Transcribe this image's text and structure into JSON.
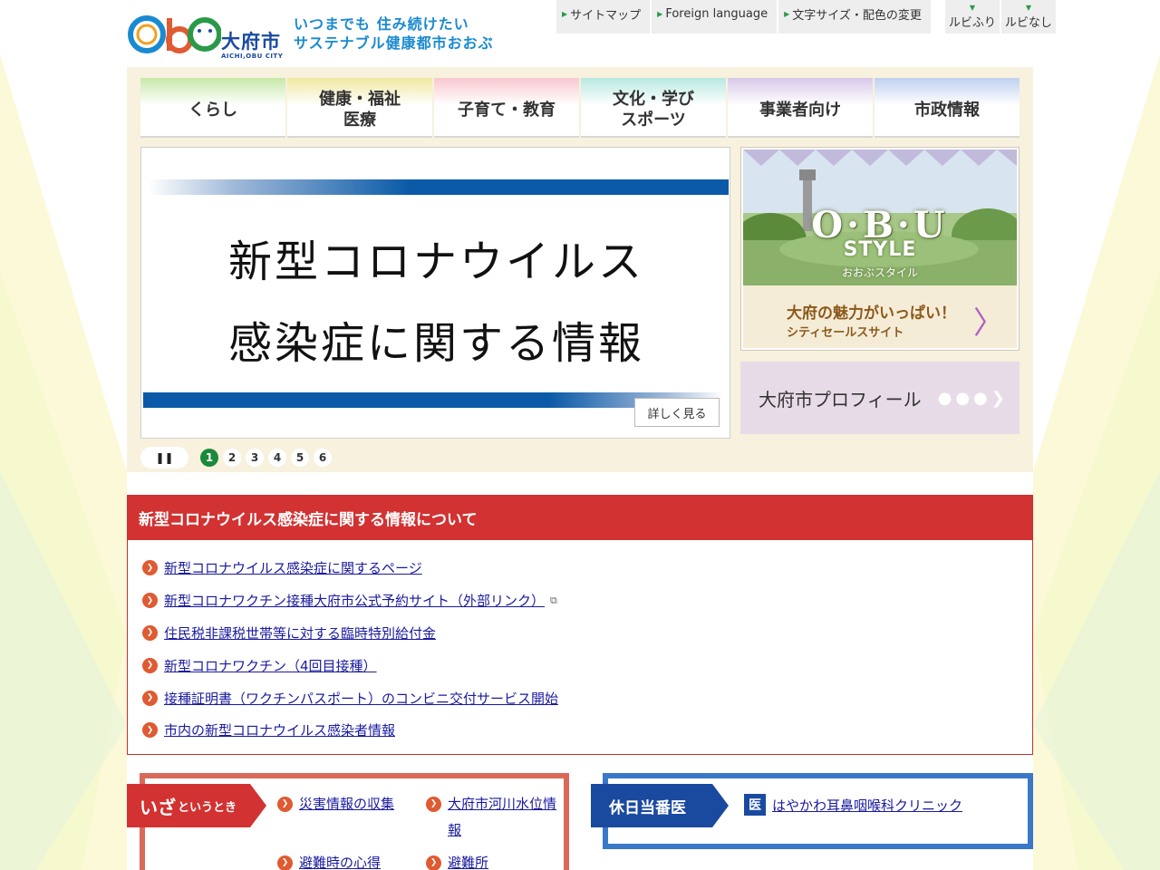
{
  "header": {
    "logo_main": "大府市",
    "logo_sub": "AICHI,OBU CITY",
    "tagline_line1": "いつまでも 住み続けたい",
    "tagline_line2": "サステナブル健康都市おおぶ",
    "util_links": [
      "サイトマップ",
      "Foreign language",
      "文字サイズ・配色の変更"
    ],
    "ruby_on": "ルビふり",
    "ruby_off": "ルビなし"
  },
  "global_nav": [
    {
      "label_line1": "くらし",
      "label_line2": "",
      "color": "#c8e8a8"
    },
    {
      "label_line1": "健康・福祉",
      "label_line2": "医療",
      "color": "#f0e8a0"
    },
    {
      "label_line1": "子育て・教育",
      "label_line2": "",
      "color": "#f8c8d0"
    },
    {
      "label_line1": "文化・学び",
      "label_line2": "スポーツ",
      "color": "#b8e8e0"
    },
    {
      "label_line1": "事業者向け",
      "label_line2": "",
      "color": "#d8c8e8"
    },
    {
      "label_line1": "市政情報",
      "label_line2": "",
      "color": "#c0d0f0"
    }
  ],
  "slider": {
    "title_line1": "新型コロナウイルス",
    "title_line2": "感染症に関する情報",
    "detail_label": "詳しく見る",
    "pause_label": "❚❚",
    "pages": [
      "1",
      "2",
      "3",
      "4",
      "5",
      "6"
    ],
    "active_page": "1"
  },
  "banners": {
    "obu_title": "O·B·U",
    "obu_style": "STYLE",
    "obu_kana": "おおぶスタイル",
    "obu_catch": "大府の魅力がいっぱい！",
    "obu_sub": "シティセールスサイト",
    "profile_label": "大府市プロフィール"
  },
  "corona": {
    "heading": "新型コロナウイルス感染症に関する情報について",
    "links": [
      "新型コロナウイルス感染症に関するページ",
      "新型コロナワクチン接種大府市公式予約サイト（外部リンク）",
      "住民税非課税世帯等に対する臨時特別給付金",
      "新型コロナワクチン（4回目接種）",
      "接種証明書（ワクチンパスポート）のコンビニ交付サービス開始",
      "市内の新型コロナウイルス感染者情報"
    ]
  },
  "emergency": {
    "tag_big": "いざ",
    "tag_small": "というとき",
    "links": [
      "災害情報の収集",
      "大府市河川水位情報",
      "避難時の心得",
      "避難所"
    ]
  },
  "holiday": {
    "tag": "休日当番医",
    "badge": "医",
    "clinic": "はやかわ耳鼻咽喉科クリニック"
  },
  "colors": {
    "accent_red": "#d23232",
    "accent_blue": "#1a4aa0",
    "panel_beige": "#f7f1de",
    "active_green": "#1a8a3a"
  }
}
